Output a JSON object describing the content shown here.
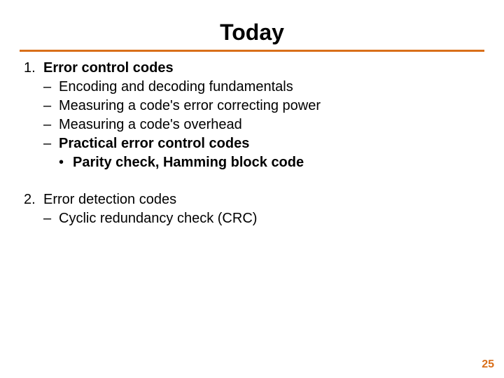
{
  "title": "Today",
  "sections": [
    {
      "number": "1.",
      "heading": "Error control codes",
      "heading_bold": true,
      "items": [
        {
          "text": "Encoding and decoding fundamentals",
          "bold": false
        },
        {
          "text": "Measuring a code's error correcting power",
          "bold": false
        },
        {
          "text": "Measuring a code's overhead",
          "bold": false
        },
        {
          "text": "Practical error control codes",
          "bold": true,
          "subitems": [
            {
              "text": "Parity check, Hamming block code",
              "bold": true
            }
          ]
        }
      ]
    },
    {
      "number": "2.",
      "heading": "Error detection codes",
      "heading_bold": false,
      "items": [
        {
          "text": "Cyclic redundancy check (CRC)",
          "bold": false
        }
      ]
    }
  ],
  "page_number": "25",
  "colors": {
    "accent": "#d96f1a"
  }
}
